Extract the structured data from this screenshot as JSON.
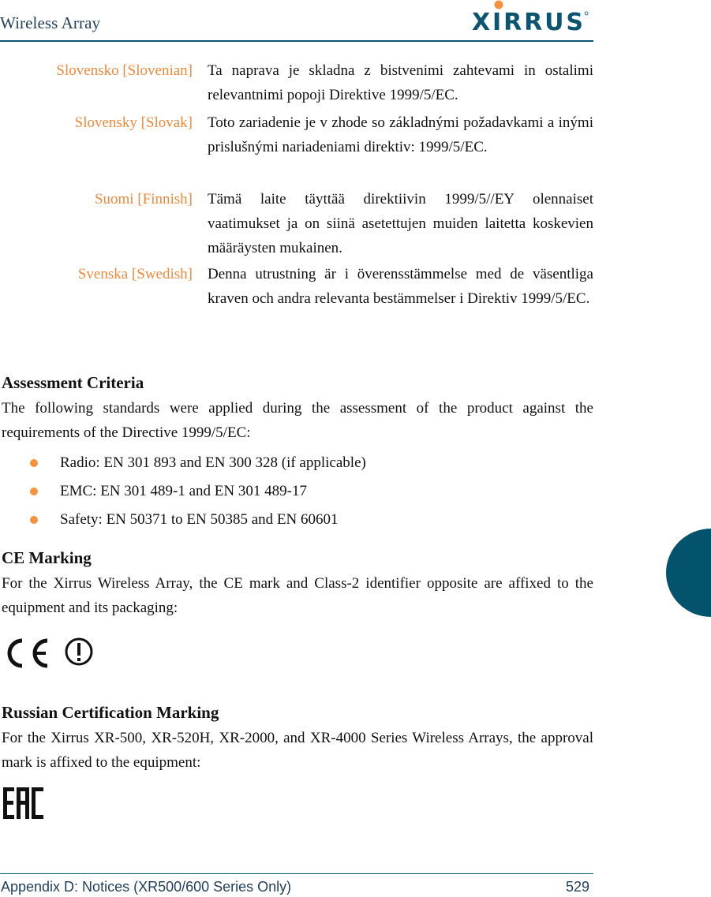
{
  "header": {
    "title": "Wireless Array",
    "logo_text": "XIRRUS"
  },
  "languages": [
    {
      "name": "Slovensko [Slovenian]",
      "text": "Ta naprava je skladna z bistvenimi zahtevami in ostalimi relevantnimi popoji Direktive 1999/5/EC."
    },
    {
      "name": "Slovensky [Slovak]",
      "text": "Toto zariadenie je v zhode so základnými požadavkami a inými prislušnými nariadeniami direktiv: 1999/5/EC."
    },
    {
      "name": "Suomi [Finnish]",
      "text": "Tämä laite täyttää direktiivin 1999/5//EY olennaiset vaatimukset ja on siinä asetettujen muiden laitetta koskevien määräysten mukainen."
    },
    {
      "name": "Svenska [Swedish]",
      "text": "Denna utrustning är i överensstämmelse med de väsentliga kraven och andra relevanta bestämmelser i Direktiv 1999/5/EC."
    }
  ],
  "assessment": {
    "heading": "Assessment Criteria",
    "intro": "The following standards were applied during the assessment of the product against the requirements of the Directive 1999/5/EC:",
    "bullets": [
      "Radio: EN 301 893 and EN 300 328 (if applicable)",
      "EMC: EN 301 489-1 and EN 301 489-17",
      "Safety: EN 50371 to EN 50385 and EN 60601"
    ]
  },
  "ce_marking": {
    "heading": "CE Marking",
    "text": "For the Xirrus Wireless Array, the CE mark and Class-2 identifier opposite are affixed to the equipment and its packaging:",
    "icons": [
      "ce-mark-icon",
      "class2-alert-icon"
    ]
  },
  "russian": {
    "heading": "Russian Certification Marking",
    "text": "For the Xirrus XR-500, XR-520H, XR-2000, and XR-4000 Series Wireless Arrays, the approval mark is affixed to the equipment:",
    "icon": "eac-mark-icon"
  },
  "footer": {
    "section": "Appendix D: Notices (XR500/600 Series Only)",
    "page_number": "529"
  },
  "colors": {
    "accent_orange": "#f0883a",
    "brand_teal": "#03536d"
  }
}
